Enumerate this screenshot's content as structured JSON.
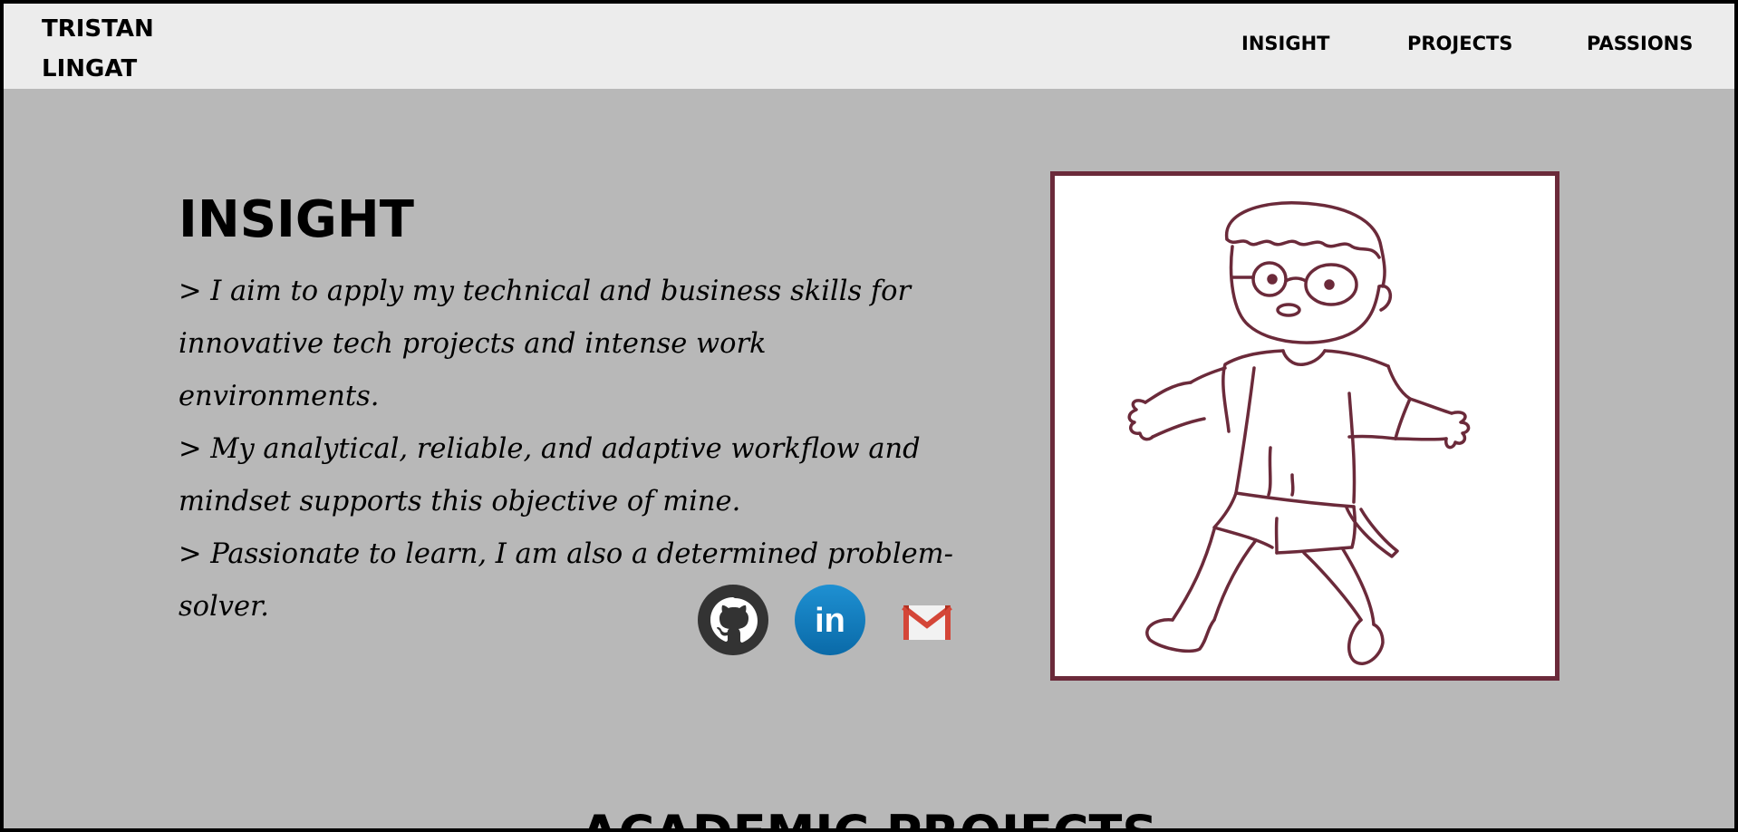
{
  "header": {
    "brand_line1": "TRISTAN",
    "brand_line2": "LINGAT",
    "nav": [
      {
        "label": "INSIGHT"
      },
      {
        "label": "PROJECTS"
      },
      {
        "label": "PASSIONS"
      }
    ]
  },
  "insight": {
    "title": "INSIGHT",
    "lines": [
      "> I aim to apply my technical and business skills for innovative tech projects and intense work environments.",
      "> My analytical, reliable, and adaptive workflow and mindset supports this objective of mine.",
      "> Passionate to learn, I am also a determined problem-solver."
    ],
    "socials": [
      {
        "icon": "github-icon"
      },
      {
        "icon": "linkedin-icon",
        "label": "in"
      },
      {
        "icon": "gmail-icon"
      }
    ]
  },
  "academic": {
    "title": "ACADEMIC PROJECTS"
  },
  "colors": {
    "page_bg": "#b8b8b8",
    "navbar_bg": "#ececec",
    "frame_border": "#6b2a3a",
    "drawing_stroke": "#6b2a3a",
    "github": "#333333",
    "linkedin": "#0a77b5",
    "gmail_red": "#d44638"
  }
}
